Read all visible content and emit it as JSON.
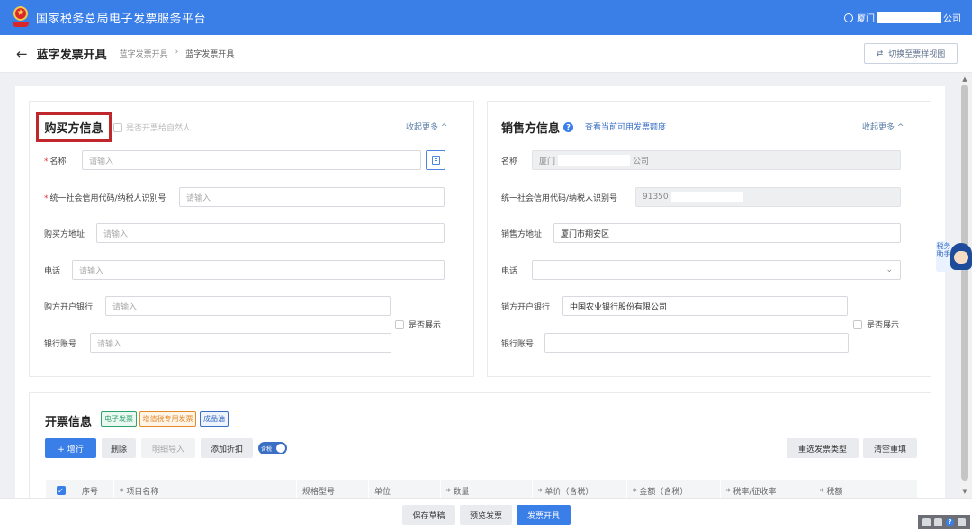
{
  "header": {
    "app_title": "国家税务总局电子发票服务平台",
    "user_prefix": "厦门",
    "user_suffix": "公司"
  },
  "subbar": {
    "back_icon": "arrow-left-icon",
    "page_title": "蓝字发票开具",
    "breadcrumb": [
      "蓝字发票开具",
      "蓝字发票开具"
    ],
    "breadcrumb_sep": "›",
    "switch_view": "切换至票样视图"
  },
  "buyer": {
    "title": "购买方信息",
    "natural_person": "是否开票给自然人",
    "collapse": "收起更多 ^",
    "fields": {
      "name_label": "名称",
      "name_placeholder": "请输入",
      "tax_id_label": "统一社会信用代码/纳税人识别号",
      "tax_id_placeholder": "请输入",
      "address_label": "购买方地址",
      "address_placeholder": "请输入",
      "phone_label": "电话",
      "phone_placeholder": "请输入",
      "bank_label": "购方开户银行",
      "bank_placeholder": "请输入",
      "account_label": "银行账号",
      "account_placeholder": "请输入"
    },
    "show_option": "是否展示"
  },
  "seller": {
    "title": "销售方信息",
    "quota_link": "查看当前可用发票额度",
    "collapse": "收起更多 ^",
    "fields": {
      "name_label": "名称",
      "name_prefix": "厦门",
      "name_suffix": "公司",
      "tax_id_label": "统一社会信用代码/纳税人识别号",
      "tax_id_value": "91350",
      "address_label": "销售方地址",
      "address_value": "厦门市翔安区",
      "phone_label": "电话",
      "phone_value": "",
      "bank_label": "销方开户银行",
      "bank_value": "中国农业银行股份有限公司",
      "account_label": "银行账号",
      "account_value": ""
    },
    "show_option": "是否展示"
  },
  "invoice": {
    "title": "开票信息",
    "tags": [
      {
        "label": "电子发票",
        "color": "#2ea36b"
      },
      {
        "label": "增值税专用发票",
        "color": "#e58a2b"
      },
      {
        "label": "成品油",
        "color": "#3a6fc4"
      }
    ],
    "toolbar": {
      "add_row": "+  增行",
      "delete": "删除",
      "import_detail": "明细导入",
      "add_discount": "添加折扣",
      "tax_toggle": "含税",
      "reselect_type": "重选发票类型",
      "clear": "清空重填"
    },
    "columns": [
      "序号",
      "* 项目名称",
      "规格型号",
      "单位",
      "* 数量",
      "* 单价（含税）",
      "* 金额（含税）",
      "* 税率/征收率",
      "* 税额"
    ]
  },
  "bottom": {
    "save_draft": "保存草稿",
    "preview": "预览发票",
    "issue": "发票开具"
  },
  "assistant": {
    "label": "税务助手"
  },
  "colors": {
    "header": "#3a7ee8",
    "primary": "#3a7ee8",
    "highlight_box": "#c0272d"
  }
}
